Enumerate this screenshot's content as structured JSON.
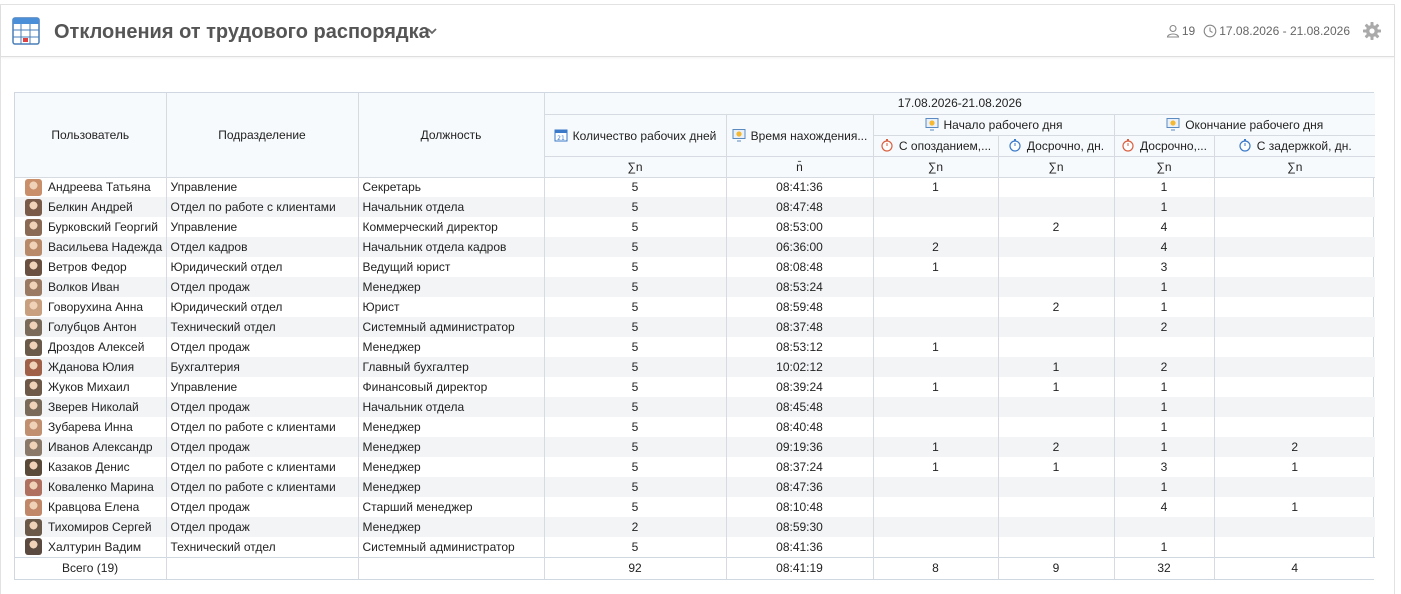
{
  "header": {
    "title": "Отклонения от трудового распорядка",
    "users_count": "19",
    "date_range": "17.08.2026 - 21.08.2026"
  },
  "table": {
    "col_user": "Пользователь",
    "col_department": "Подразделение",
    "col_position": "Должность",
    "period": "17.08.2026-21.08.2026",
    "col_workdays": "Количество рабочих дней",
    "col_time": "Время нахождения...",
    "group_start": "Начало рабочего дня",
    "group_end": "Окончание рабочего дня",
    "col_late": "С опозданием,...",
    "col_early_start": "Досрочно, дн.",
    "col_early_end": "Досрочно,...",
    "col_delay": "С задержкой, дн.",
    "agg_sum": "∑n",
    "agg_avg": "n̄",
    "rows": [
      {
        "user": "Андреева Татьяна",
        "dept": "Управление",
        "pos": "Секретарь",
        "days": "5",
        "time": "08:41:36",
        "late": "1",
        "early_s": "",
        "early_e": "1",
        "delay": ""
      },
      {
        "user": "Белкин Андрей",
        "dept": "Отдел по работе с клиентами",
        "pos": "Начальник отдела",
        "days": "5",
        "time": "08:47:48",
        "late": "",
        "early_s": "",
        "early_e": "1",
        "delay": ""
      },
      {
        "user": "Бурковский Георгий",
        "dept": "Управление",
        "pos": "Коммерческий директор",
        "days": "5",
        "time": "08:53:00",
        "late": "",
        "early_s": "2",
        "early_e": "4",
        "delay": ""
      },
      {
        "user": "Васильева Надежда",
        "dept": "Отдел кадров",
        "pos": "Начальник отдела кадров",
        "days": "5",
        "time": "06:36:00",
        "late": "2",
        "early_s": "",
        "early_e": "4",
        "delay": ""
      },
      {
        "user": "Ветров Федор",
        "dept": "Юридический отдел",
        "pos": "Ведущий юрист",
        "days": "5",
        "time": "08:08:48",
        "late": "1",
        "early_s": "",
        "early_e": "3",
        "delay": ""
      },
      {
        "user": "Волков Иван",
        "dept": "Отдел продаж",
        "pos": "Менеджер",
        "days": "5",
        "time": "08:53:24",
        "late": "",
        "early_s": "",
        "early_e": "1",
        "delay": ""
      },
      {
        "user": "Говорухина Анна",
        "dept": "Юридический отдел",
        "pos": "Юрист",
        "days": "5",
        "time": "08:59:48",
        "late": "",
        "early_s": "2",
        "early_e": "1",
        "delay": ""
      },
      {
        "user": "Голубцов Антон",
        "dept": "Технический отдел",
        "pos": "Системный администратор",
        "days": "5",
        "time": "08:37:48",
        "late": "",
        "early_s": "",
        "early_e": "2",
        "delay": ""
      },
      {
        "user": "Дроздов Алексей",
        "dept": "Отдел продаж",
        "pos": "Менеджер",
        "days": "5",
        "time": "08:53:12",
        "late": "1",
        "early_s": "",
        "early_e": "",
        "delay": ""
      },
      {
        "user": "Жданова Юлия",
        "dept": "Бухгалтерия",
        "pos": "Главный бухгалтер",
        "days": "5",
        "time": "10:02:12",
        "late": "",
        "early_s": "1",
        "early_e": "2",
        "delay": ""
      },
      {
        "user": "Жуков Михаил",
        "dept": "Управление",
        "pos": "Финансовый директор",
        "days": "5",
        "time": "08:39:24",
        "late": "1",
        "early_s": "1",
        "early_e": "1",
        "delay": ""
      },
      {
        "user": "Зверев Николай",
        "dept": "Отдел продаж",
        "pos": "Начальник отдела",
        "days": "5",
        "time": "08:45:48",
        "late": "",
        "early_s": "",
        "early_e": "1",
        "delay": ""
      },
      {
        "user": "Зубарева Инна",
        "dept": "Отдел по работе с клиентами",
        "pos": "Менеджер",
        "days": "5",
        "time": "08:40:48",
        "late": "",
        "early_s": "",
        "early_e": "1",
        "delay": ""
      },
      {
        "user": "Иванов Александр",
        "dept": "Отдел продаж",
        "pos": "Менеджер",
        "days": "5",
        "time": "09:19:36",
        "late": "1",
        "early_s": "2",
        "early_e": "1",
        "delay": "2"
      },
      {
        "user": "Казаков Денис",
        "dept": "Отдел по работе с клиентами",
        "pos": "Менеджер",
        "days": "5",
        "time": "08:37:24",
        "late": "1",
        "early_s": "1",
        "early_e": "3",
        "delay": "1"
      },
      {
        "user": "Коваленко Марина",
        "dept": "Отдел по работе с клиентами",
        "pos": "Менеджер",
        "days": "5",
        "time": "08:47:36",
        "late": "",
        "early_s": "",
        "early_e": "1",
        "delay": ""
      },
      {
        "user": "Кравцова Елена",
        "dept": "Отдел продаж",
        "pos": "Старший менеджер",
        "days": "5",
        "time": "08:10:48",
        "late": "",
        "early_s": "",
        "early_e": "4",
        "delay": "1"
      },
      {
        "user": "Тихомиров Сергей",
        "dept": "Отдел продаж",
        "pos": "Менеджер",
        "days": "2",
        "time": "08:59:30",
        "late": "",
        "early_s": "",
        "early_e": "",
        "delay": ""
      },
      {
        "user": "Халтурин Вадим",
        "dept": "Технический отдел",
        "pos": "Системный администратор",
        "days": "5",
        "time": "08:41:36",
        "late": "",
        "early_s": "",
        "early_e": "1",
        "delay": ""
      }
    ],
    "totals": {
      "label": "Всего (19)",
      "days": "92",
      "time": "08:41:19",
      "late": "8",
      "early_s": "9",
      "early_e": "32",
      "delay": "4"
    }
  },
  "colors": {
    "accent": "#4a8fd8",
    "header_bg": "#f7fafc",
    "stripe": "#f3f4f6",
    "border": "#d5dbe1"
  },
  "avatar_colors": [
    "#c98f6a",
    "#7a5a48",
    "#8a6a55",
    "#b98a6a",
    "#6a5040",
    "#9a7a62",
    "#c8a080",
    "#7a6a5a",
    "#6a5a4a",
    "#a06048",
    "#6e5848",
    "#7a6a5a",
    "#c09070",
    "#8a7868",
    "#5a4a3a",
    "#b07060",
    "#c08868",
    "#6a5848",
    "#5a4a40"
  ]
}
